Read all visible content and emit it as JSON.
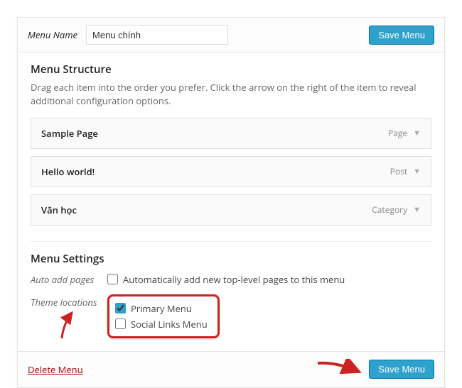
{
  "header": {
    "menu_name_label": "Menu Name",
    "menu_name_value": "Menu chính",
    "save_button": "Save Menu"
  },
  "structure": {
    "heading": "Menu Structure",
    "description": "Drag each item into the order you prefer. Click the arrow on the right of the item to reveal additional configuration options.",
    "items": [
      {
        "title": "Sample Page",
        "type": "Page"
      },
      {
        "title": "Hello world!",
        "type": "Post"
      },
      {
        "title": "Văn học",
        "type": "Category"
      }
    ]
  },
  "settings": {
    "heading": "Menu Settings",
    "auto_add": {
      "label": "Auto add pages",
      "text": "Automatically add new top-level pages to this menu",
      "checked": false
    },
    "theme_locations": {
      "label": "Theme locations",
      "options": [
        {
          "text": "Primary Menu",
          "checked": true
        },
        {
          "text": "Social Links Menu",
          "checked": false
        }
      ]
    }
  },
  "footer": {
    "delete": "Delete Menu",
    "save": "Save Menu"
  },
  "annotations": {
    "highlight_color": "#cc2222"
  }
}
